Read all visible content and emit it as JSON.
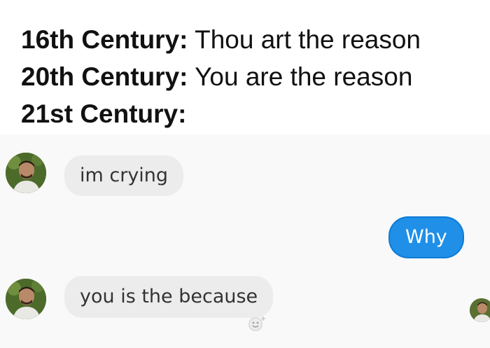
{
  "caption": {
    "lines": [
      {
        "era": "16th Century:",
        "text": " Thou art the reason"
      },
      {
        "era": "20th Century:",
        "text": " You are the reason"
      },
      {
        "era": "21st Century:",
        "text": ""
      }
    ]
  },
  "chat": {
    "messages": [
      {
        "side": "incoming",
        "text": "im crying"
      },
      {
        "side": "outgoing",
        "text": "Why"
      },
      {
        "side": "incoming",
        "text": "you is the because"
      }
    ]
  },
  "colors": {
    "outgoing_bubble": "#1f8fe8",
    "incoming_bubble": "#ececec"
  },
  "icons": {
    "reaction": "emoji-react-icon",
    "avatar": "user-avatar"
  }
}
